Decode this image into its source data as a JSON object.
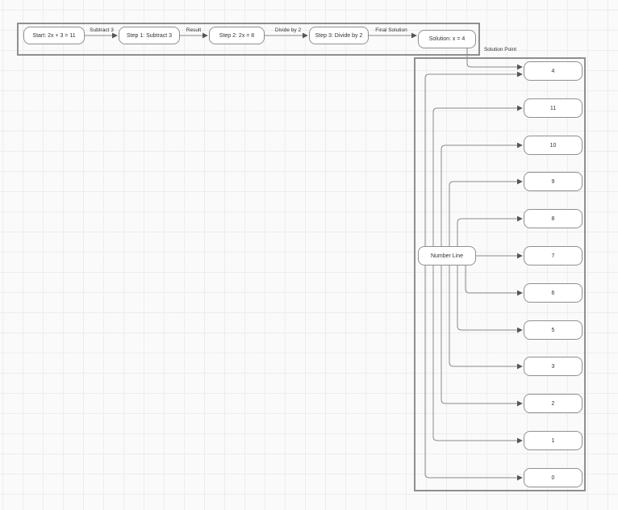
{
  "diagram": {
    "flow": {
      "nodes": {
        "start": "Start: 2x + 3 = 11",
        "step1": "Step 1: Subtract 3",
        "step2": "Step 2: 2x = 8",
        "step3": "Step 3: Divide by 2",
        "solution": "Solution: x = 4"
      },
      "edge_labels": {
        "e1": "Subtract 3",
        "e2": "Result",
        "e3": "Divide by 2",
        "e4": "Final Solution"
      }
    },
    "solution_edge_label": "Solution Point",
    "number_line": {
      "hub": "Number Line",
      "values": [
        "4",
        "11",
        "10",
        "9",
        "8",
        "7",
        "6",
        "5",
        "3",
        "2",
        "1",
        "0"
      ]
    },
    "edges": [
      {
        "from": "Start: 2x + 3 = 11",
        "to": "Step 1: Subtract 3",
        "label": "Subtract 3"
      },
      {
        "from": "Step 1: Subtract 3",
        "to": "Step 2: 2x = 8",
        "label": "Result"
      },
      {
        "from": "Step 2: 2x = 8",
        "to": "Step 3: Divide by 2",
        "label": "Divide by 2"
      },
      {
        "from": "Step 3: Divide by 2",
        "to": "Solution: x = 4",
        "label": "Final Solution"
      },
      {
        "from": "Solution: x = 4",
        "to": "4",
        "label": "Solution Point"
      },
      {
        "from": "Number Line",
        "to": "4"
      },
      {
        "from": "Number Line",
        "to": "11"
      },
      {
        "from": "Number Line",
        "to": "10"
      },
      {
        "from": "Number Line",
        "to": "9"
      },
      {
        "from": "Number Line",
        "to": "8"
      },
      {
        "from": "Number Line",
        "to": "7"
      },
      {
        "from": "Number Line",
        "to": "6"
      },
      {
        "from": "Number Line",
        "to": "5"
      },
      {
        "from": "Number Line",
        "to": "3"
      },
      {
        "from": "Number Line",
        "to": "2"
      },
      {
        "from": "Number Line",
        "to": "1"
      },
      {
        "from": "Number Line",
        "to": "0"
      }
    ],
    "colors": {
      "background": "#fafafa",
      "grid_line": "#ededed",
      "node_fill": "#ffffff",
      "node_border": "#909090",
      "container_border": "#8f8f8f",
      "edge": "#8a8a8a",
      "arrowhead": "#555555",
      "text": "#333333"
    }
  }
}
